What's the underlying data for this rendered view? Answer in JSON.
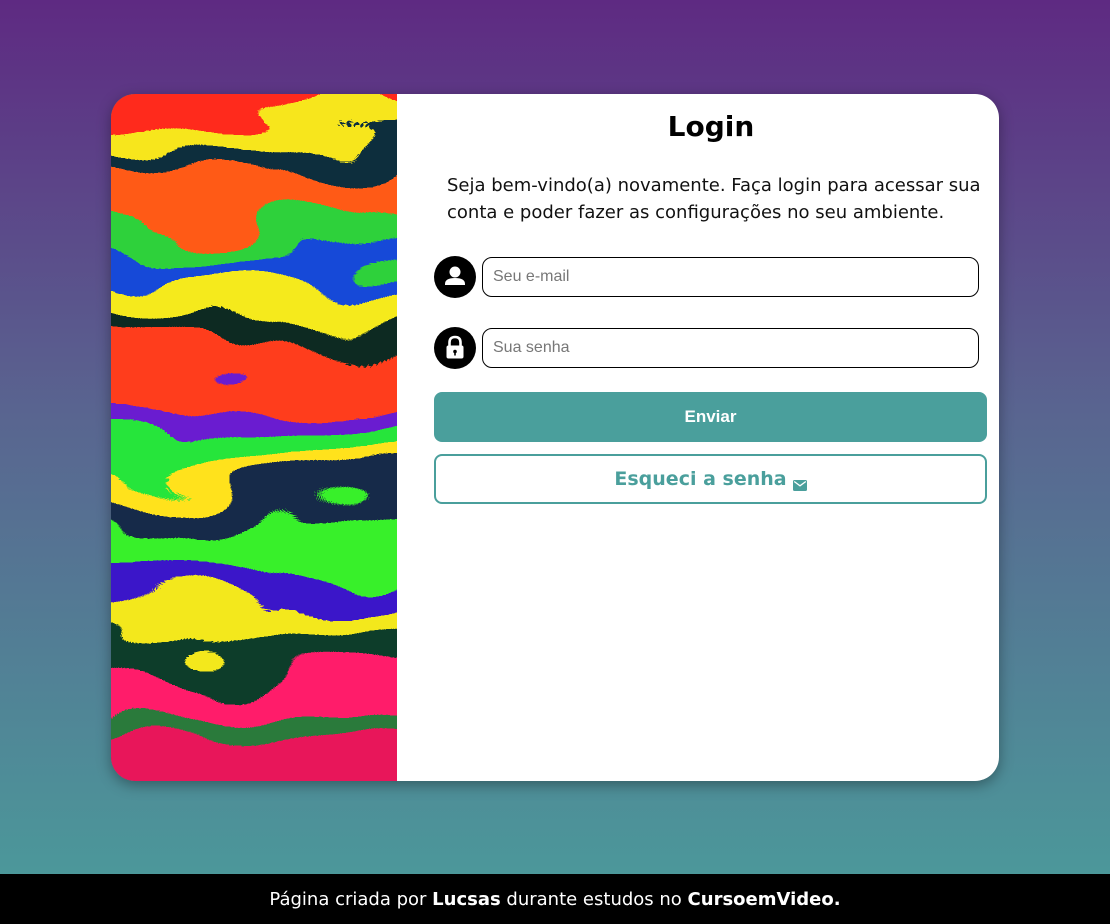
{
  "login": {
    "title": "Login",
    "intro": "Seja bem-vindo(a) novamente. Faça login para acessar sua conta e poder fazer as configurações no seu ambiente.",
    "email": {
      "placeholder": "Seu e-mail",
      "value": "",
      "icon": "user-icon"
    },
    "password": {
      "placeholder": "Sua senha",
      "value": "",
      "icon": "lock-icon"
    },
    "submit_label": "Enviar",
    "forgot_label": "Esqueci a senha",
    "forgot_icon": "mail-icon"
  },
  "footer": {
    "prefix": "Página criada por ",
    "author": "Lucsas",
    "middle": " durante estudos no ",
    "course": "CursoemVideo."
  },
  "colors": {
    "accent": "#4a9f9c",
    "gradient_top": "#5e2a82",
    "gradient_bottom": "#4a9d9b",
    "footer_bg": "#000000"
  }
}
